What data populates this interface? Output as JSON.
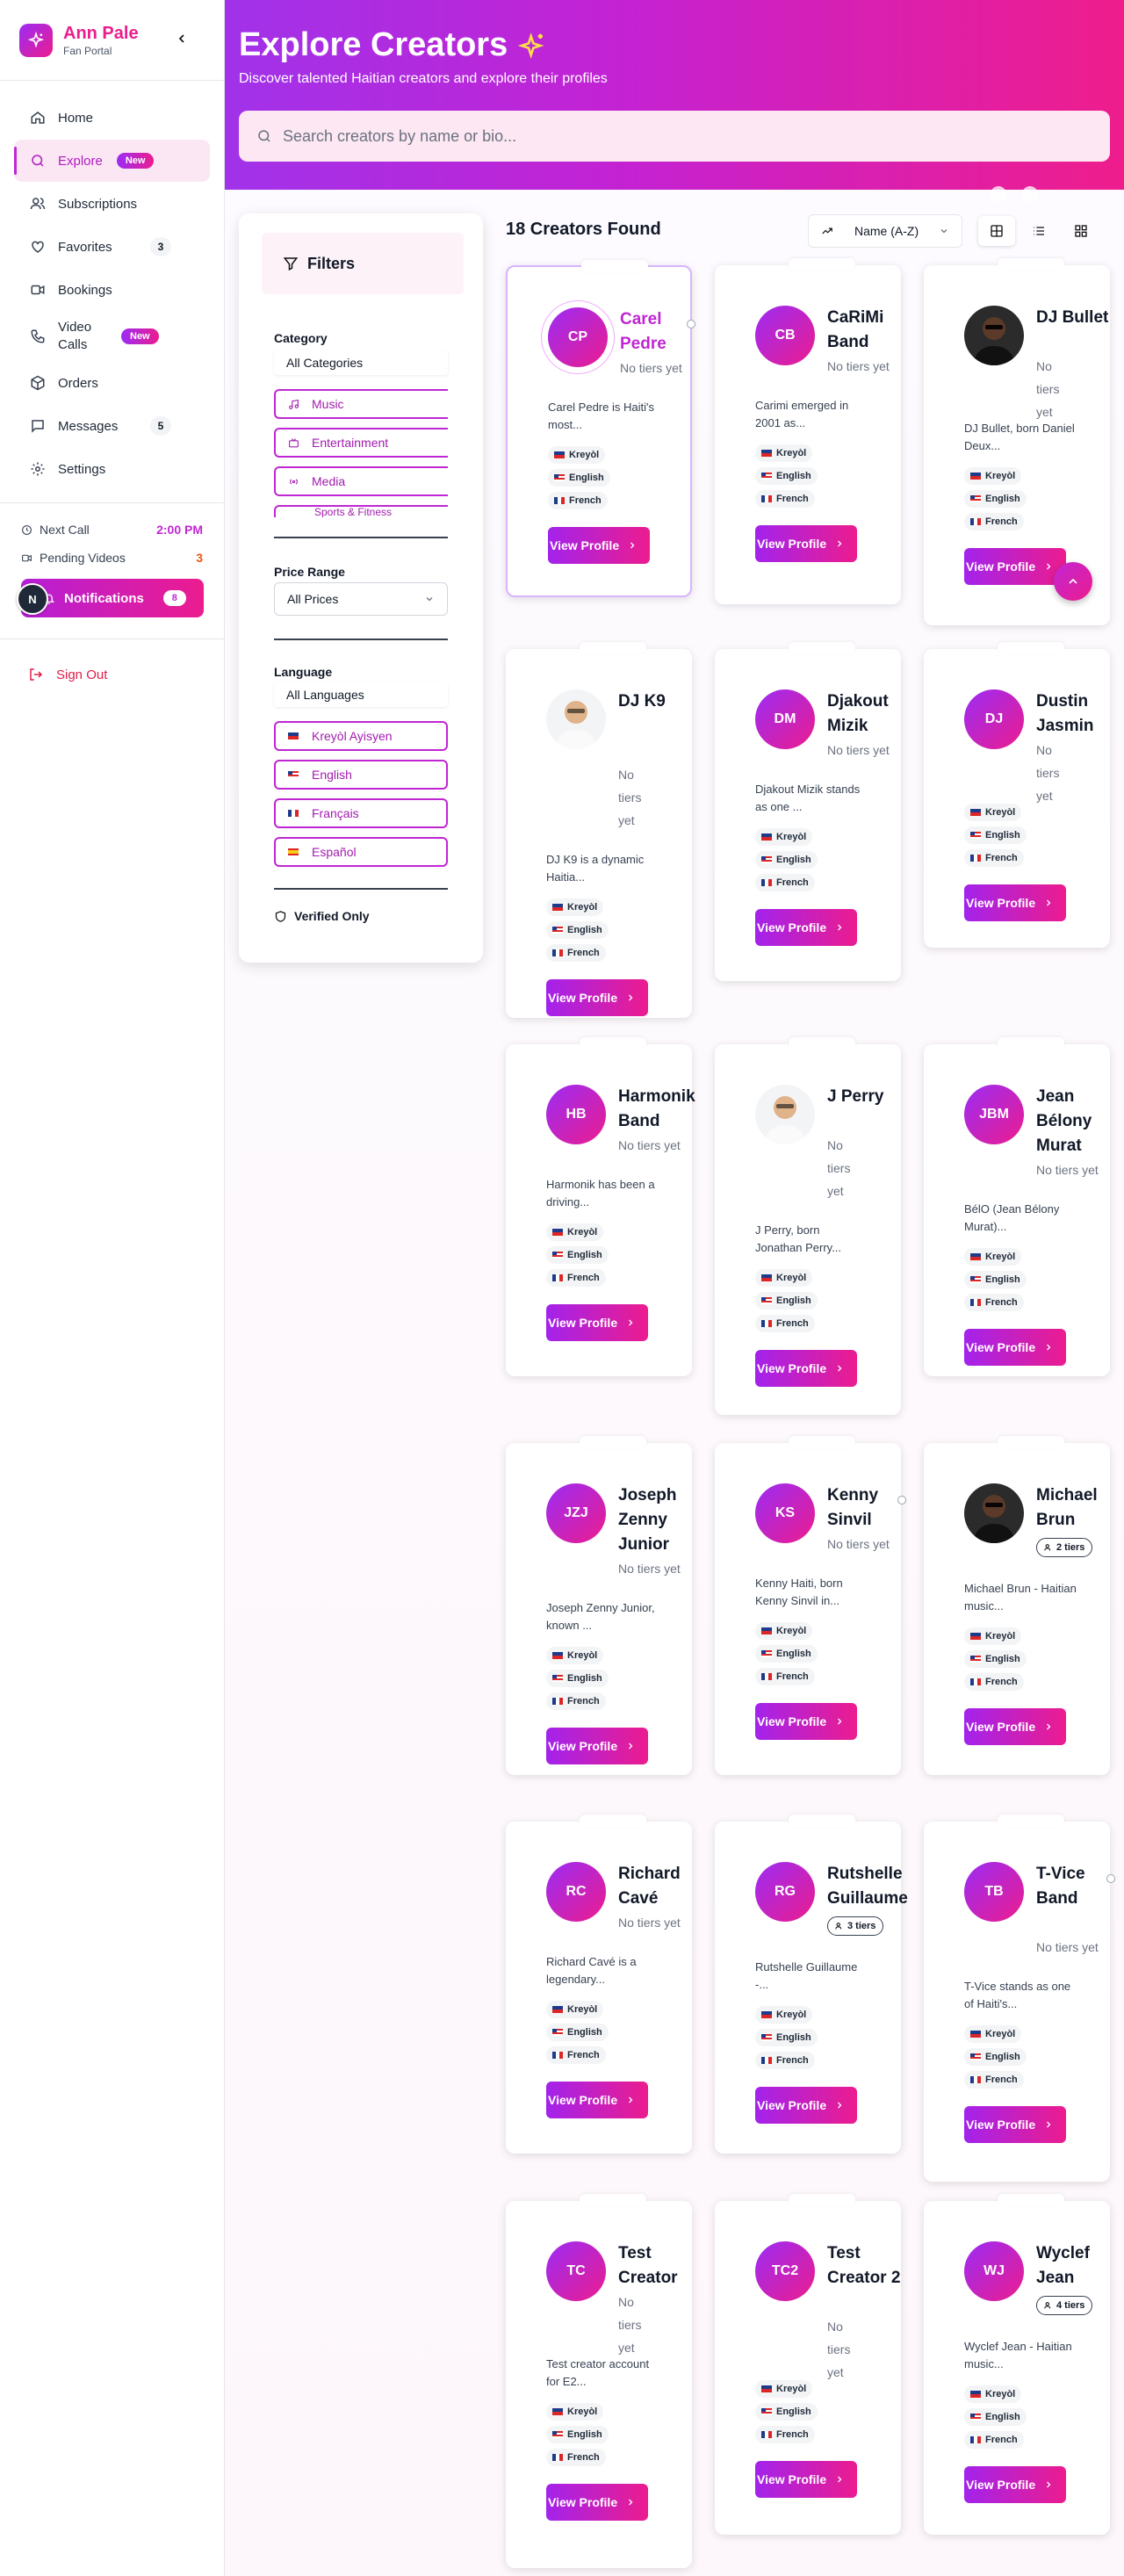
{
  "brand": {
    "name": "Ann Pale",
    "subtitle": "Fan Portal"
  },
  "nav": [
    {
      "label": "Home",
      "icon": "home-icon"
    },
    {
      "label": "Explore",
      "icon": "search-icon",
      "badge": "New",
      "active": true
    },
    {
      "label": "Subscriptions",
      "icon": "users-icon"
    },
    {
      "label": "Favorites",
      "icon": "heart-icon",
      "count": "3"
    },
    {
      "label": "Bookings",
      "icon": "video-icon"
    },
    {
      "label": "Video Calls",
      "icon": "phone-icon",
      "badge": "New"
    },
    {
      "label": "Orders",
      "icon": "package-icon"
    },
    {
      "label": "Messages",
      "icon": "message-icon",
      "count": "5"
    },
    {
      "label": "Settings",
      "icon": "gear-icon"
    }
  ],
  "stats": {
    "next_call_label": "Next Call",
    "next_call_value": "2:00 PM",
    "pending_label": "Pending Videos",
    "pending_value": "3"
  },
  "notifications": {
    "label": "Notifications",
    "count": "8"
  },
  "user_avatar": "N",
  "signout": "Sign Out",
  "header": {
    "title": "Explore Creators",
    "subtitle": "Discover talented Haitian creators and explore their profiles",
    "search_placeholder": "Search creators by name or bio..."
  },
  "filters": {
    "title": "Filters",
    "category_label": "Category",
    "category_value": "All Categories",
    "categories": [
      "Music",
      "Entertainment",
      "Media",
      "Sports & Fitness"
    ],
    "price_label": "Price Range",
    "price_value": "All Prices",
    "language_label": "Language",
    "language_value": "All Languages",
    "languages": [
      "Kreyòl Ayisyen",
      "English",
      "Français",
      "Español"
    ],
    "verified_label": "Verified Only"
  },
  "toolbar": {
    "found": "18 Creators Found",
    "sort": "Name (A-Z)"
  },
  "card_common": {
    "view_profile": "View Profile",
    "no_tiers": "No tiers yet",
    "langs": [
      "Kreyòl",
      "English",
      "French"
    ]
  },
  "creators": [
    {
      "initials": "CP",
      "name": "Carel Pedre",
      "bio": "Carel Pedre is Haiti's most...",
      "tiers": "No tiers yet"
    },
    {
      "initials": "CB",
      "name": "CaRiMi Band",
      "bio": "Carimi emerged in 2001 as...",
      "tiers": "No tiers yet"
    },
    {
      "initials": "",
      "name": "DJ Bullet",
      "bio": "DJ Bullet, born Daniel Deux...",
      "tiers": "No tiers yet"
    },
    {
      "initials": "",
      "name": "DJ K9",
      "bio": "DJ K9 is a dynamic Haitia...",
      "tiers": "No tiers yet"
    },
    {
      "initials": "DM",
      "name": "Djakout Mizik",
      "bio": "Djakout Mizik stands as one ...",
      "tiers": "No tiers yet"
    },
    {
      "initials": "DJ",
      "name": "Dustin Jasmin",
      "bio": "",
      "tiers": "No tiers yet"
    },
    {
      "initials": "HB",
      "name": "Harmonik Band",
      "bio": "Harmonik has been a driving...",
      "tiers": "No tiers yet"
    },
    {
      "initials": "",
      "name": "J Perry",
      "bio": "J Perry, born Jonathan Perry...",
      "tiers": "No tiers yet"
    },
    {
      "initials": "JBM",
      "name": "Jean Bélony Murat",
      "bio": "BélO (Jean Bélony Murat)...",
      "tiers": "No tiers yet"
    },
    {
      "initials": "JZJ",
      "name": "Joseph Zenny Junior",
      "bio": "Joseph Zenny Junior, known ...",
      "tiers": "No tiers yet"
    },
    {
      "initials": "KS",
      "name": "Kenny Sinvil",
      "bio": "Kenny Haiti, born Kenny Sinvil in...",
      "tiers": "No tiers yet"
    },
    {
      "initials": "",
      "name": "Michael Brun",
      "bio": "Michael Brun - Haitian music...",
      "tiers": "2 tiers"
    },
    {
      "initials": "RC",
      "name": "Richard Cavé",
      "bio": "Richard Cavé is a legendary...",
      "tiers": "No tiers yet"
    },
    {
      "initials": "RG",
      "name": "Rutshelle Guillaume",
      "bio": "Rutshelle Guillaume -...",
      "tiers": "3 tiers"
    },
    {
      "initials": "TB",
      "name": "T-Vice Band",
      "bio": "T-Vice stands as one of Haiti's...",
      "tiers": "No tiers yet"
    },
    {
      "initials": "TC",
      "name": "Test Creator",
      "bio": "Test creator account for E2...",
      "tiers": "No tiers yet"
    },
    {
      "initials": "TC2",
      "name": "Test Creator 2",
      "bio": "",
      "tiers": "No tiers yet"
    },
    {
      "initials": "WJ",
      "name": "Wyclef Jean",
      "bio": "Wyclef Jean - Haitian music...",
      "tiers": "4 tiers"
    }
  ],
  "colors": {
    "accent": "#c026d3",
    "pink": "#ec1c8e",
    "purple": "#9b2cf5"
  }
}
